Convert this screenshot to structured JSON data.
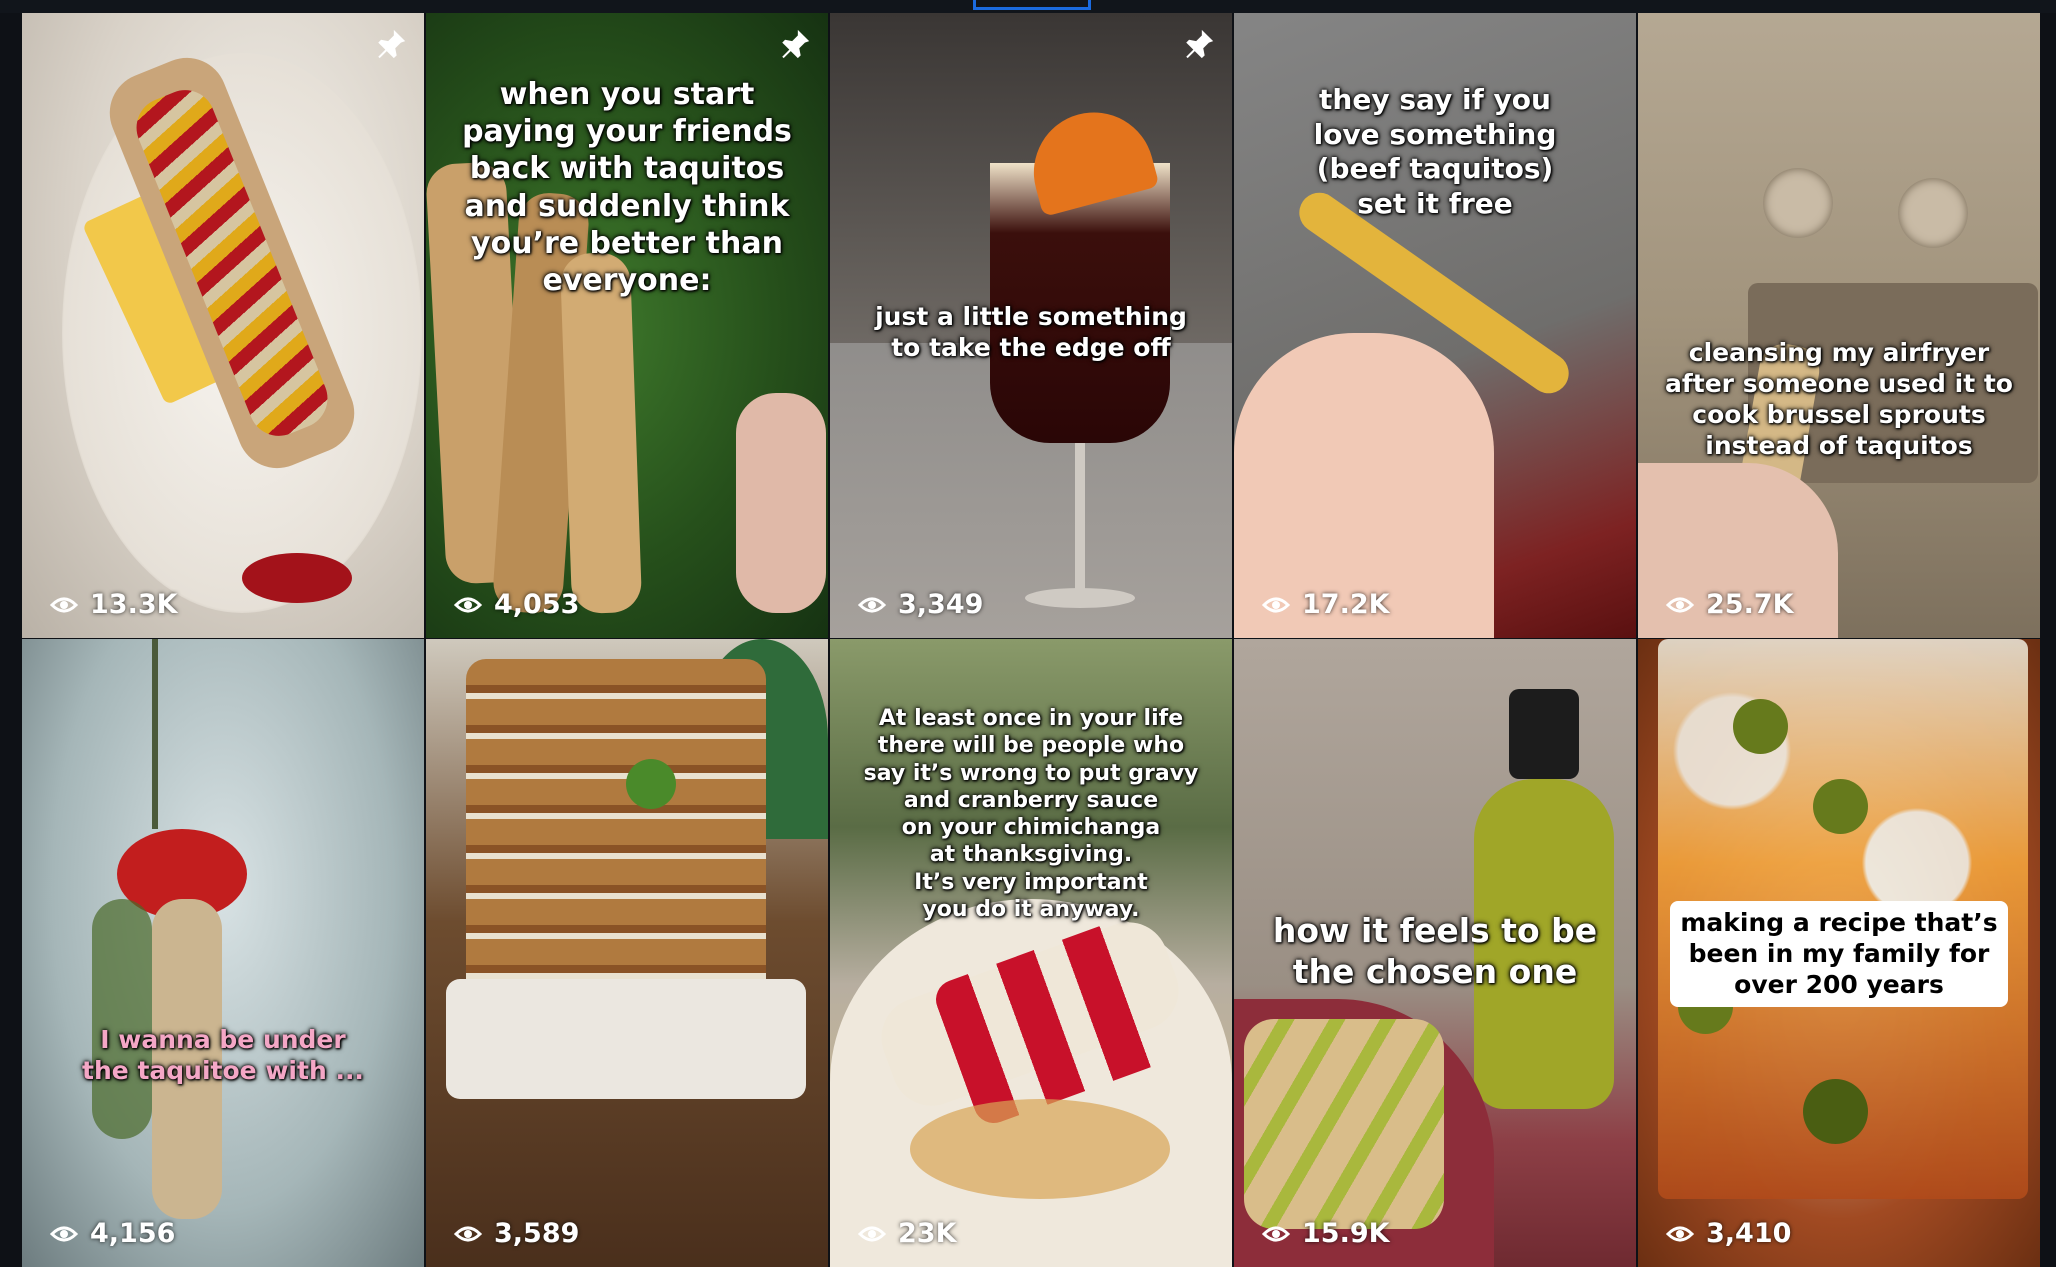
{
  "grid": {
    "tiles": [
      {
        "views": "13.3K",
        "pinned": true,
        "caption": ""
      },
      {
        "views": "4,053",
        "pinned": true,
        "caption": "when you start\npaying your friends\nback with taquitos\nand suddenly think\nyou’re better than\neveryone:"
      },
      {
        "views": "3,349",
        "pinned": true,
        "caption": "just a little something\nto take the edge off"
      },
      {
        "views": "17.2K",
        "pinned": false,
        "caption": "they say if you\nlove something\n(beef taquitos)\nset it free"
      },
      {
        "views": "25.7K",
        "pinned": false,
        "caption": "cleansing my airfryer\nafter someone used it to\ncook brussel sprouts\ninstead of taquitos"
      },
      {
        "views": "4,156",
        "pinned": false,
        "caption": "I wanna be under\nthe taquitoe with ..."
      },
      {
        "views": "3,589",
        "pinned": false,
        "caption": ""
      },
      {
        "views": "23K",
        "pinned": false,
        "caption": "At least once in your life\nthere will be people who\nsay it’s wrong to put gravy\nand cranberry sauce\non your chimichanga\nat thanksgiving.\nIt’s very important\nyou do it anyway."
      },
      {
        "views": "15.9K",
        "pinned": false,
        "caption": "how it feels to be\nthe chosen one"
      },
      {
        "views": "3,410",
        "pinned": false,
        "caption": "making a recipe that’s\nbeen in my family for\nover 200 years"
      }
    ]
  },
  "icons": {
    "views": "eye-icon",
    "pin": "pin-icon"
  },
  "colors": {
    "background": "#0e1116",
    "text": "#ffffff",
    "pink_caption": "#f4a7c6",
    "tab_indicator": "#1b6be0"
  }
}
